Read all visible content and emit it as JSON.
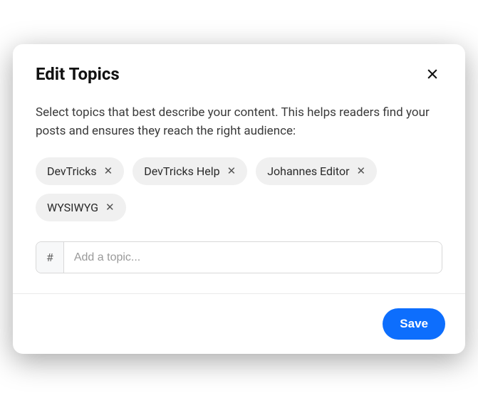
{
  "modal": {
    "title": "Edit Topics",
    "description": "Select topics that best describe your content. This helps readers find your posts and ensures they reach the right audience:",
    "tags": [
      {
        "label": "DevTricks"
      },
      {
        "label": "DevTricks Help"
      },
      {
        "label": "Johannes Editor"
      },
      {
        "label": "WYSIWYG"
      }
    ],
    "input": {
      "prefix": "#",
      "placeholder": "Add a topic..."
    },
    "save_label": "Save"
  }
}
